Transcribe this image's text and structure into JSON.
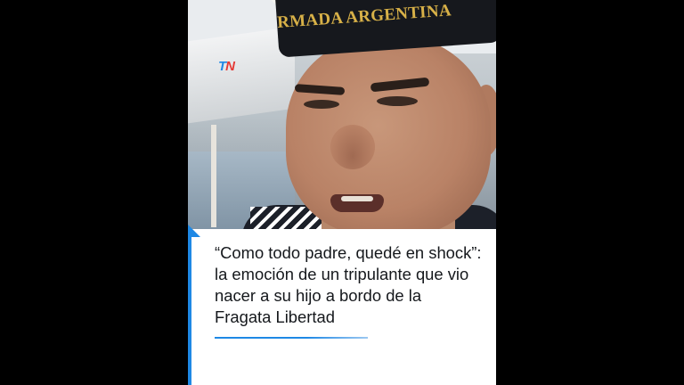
{
  "video": {
    "cap_text": "RMADA ARGENTINA",
    "logo": {
      "text_t": "T",
      "text_n": "N",
      "name": "tn-logo"
    },
    "headline": "“Como todo padre, quedé en shock”: la emoción de un tripulante que vio nacer a su hijo a bordo de la Fragata Libertad"
  },
  "colors": {
    "accent": "#1e88e5",
    "logo_red": "#e53935",
    "cap_gold": "#d8b148",
    "background": "#000000"
  }
}
